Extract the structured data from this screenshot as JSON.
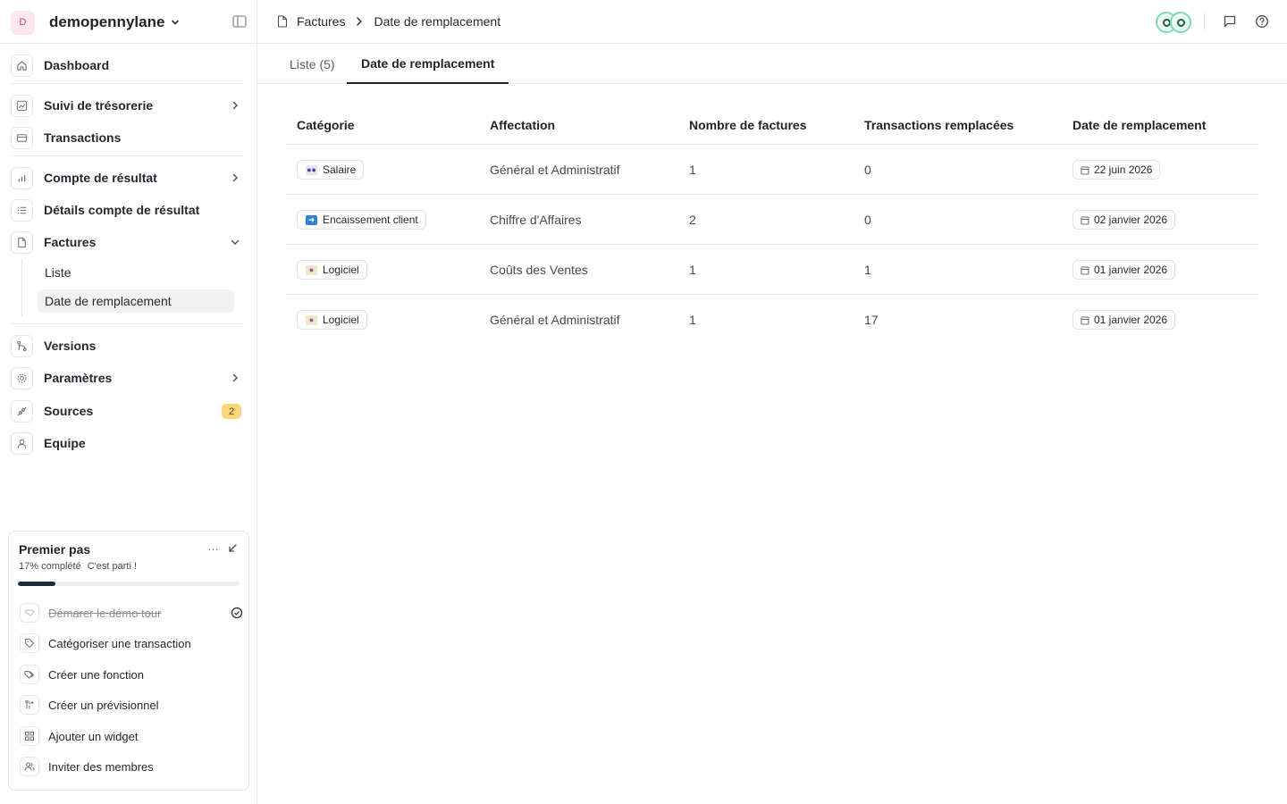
{
  "org": {
    "initial": "D",
    "name": "demopennylane"
  },
  "sidebar": {
    "items": [
      {
        "label": "Dashboard"
      },
      {
        "label": "Suivi de trésorerie"
      },
      {
        "label": "Transactions"
      },
      {
        "label": "Compte de résultat"
      },
      {
        "label": "Détails compte de résultat"
      },
      {
        "label": "Factures"
      },
      {
        "label": "Versions"
      },
      {
        "label": "Paramètres"
      },
      {
        "label": "Sources",
        "badge": "2"
      },
      {
        "label": "Equipe"
      }
    ],
    "factures_sub": [
      {
        "label": "Liste"
      },
      {
        "label": "Date de remplacement"
      }
    ]
  },
  "onboarding": {
    "title": "Premier pas",
    "menu": "···",
    "progress_text": "17% complété",
    "progress_sub": "C'est parti !",
    "progress": 0.17,
    "tasks": [
      {
        "label": "Démarer le démo tour",
        "done": true
      },
      {
        "label": "Catégoriser une transaction"
      },
      {
        "label": "Créer une fonction"
      },
      {
        "label": "Créer un prévisionnel"
      },
      {
        "label": "Ajouter un widget"
      },
      {
        "label": "Inviter des membres"
      }
    ]
  },
  "header": {
    "breadcrumb": [
      "Factures",
      "Date de remplacement"
    ]
  },
  "tabs": [
    {
      "label": "Liste (5)"
    },
    {
      "label": "Date de remplacement",
      "active": true
    }
  ],
  "table": {
    "columns": [
      "Catégorie",
      "Affectation",
      "Nombre de factures",
      "Transactions remplacées",
      "Date de remplacement"
    ],
    "rows": [
      {
        "category": "Salaire",
        "category_icon": "people-emoji",
        "affectation": "Général et Administratif",
        "count": "1",
        "replaced": "0",
        "date": "22 juin 2026"
      },
      {
        "category": "Encaissement client",
        "category_icon": "arrow-emoji",
        "affectation": "Chiffre d'Affaires",
        "count": "2",
        "replaced": "0",
        "date": "02 janvier 2026"
      },
      {
        "category": "Logiciel",
        "category_icon": "technologist-emoji",
        "affectation": "Coûts des Ventes",
        "count": "1",
        "replaced": "1",
        "date": "01 janvier 2026"
      },
      {
        "category": "Logiciel",
        "category_icon": "technologist-emoji",
        "affectation": "Général et Administratif",
        "count": "1",
        "replaced": "17",
        "date": "01 janvier 2026"
      }
    ]
  },
  "colors": {
    "accent": "#1f2328",
    "badge": "#fcd67a",
    "avatar_ring": "#7fd8b4"
  }
}
